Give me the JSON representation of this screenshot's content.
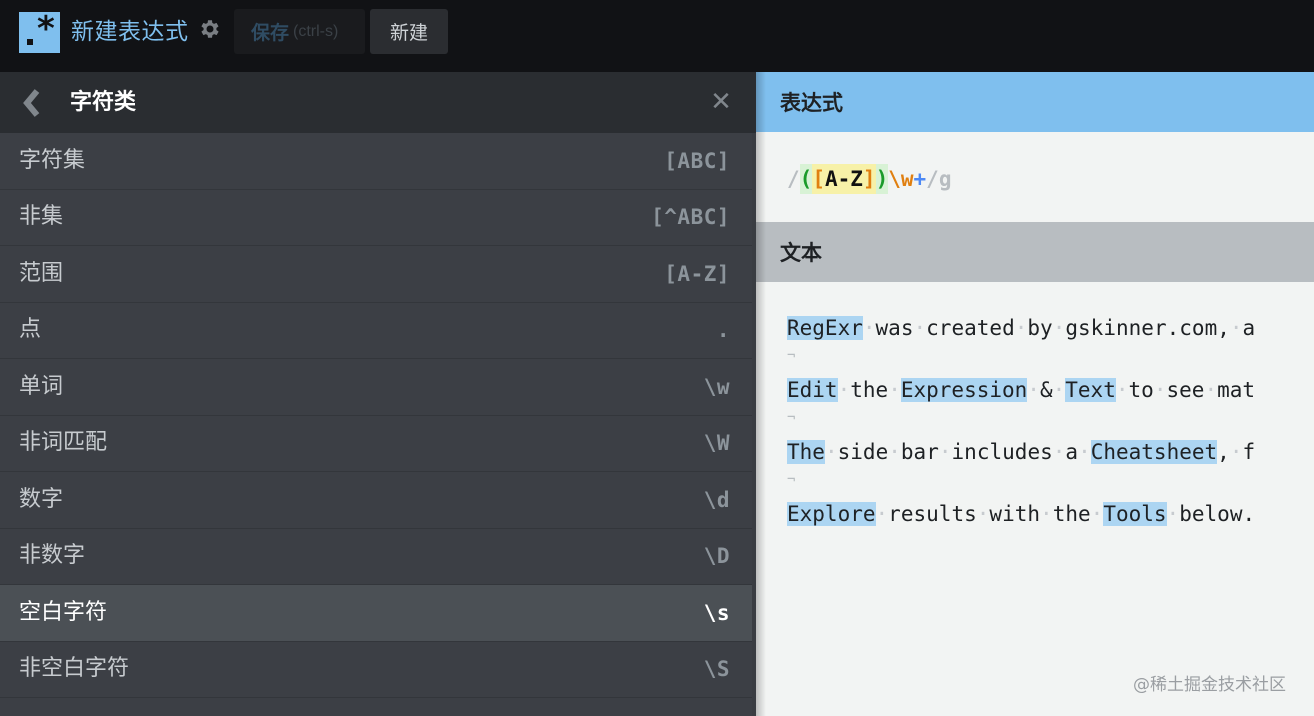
{
  "topbar": {
    "logo_icon": "regex-logo-icon",
    "title": "新建表达式",
    "settings_icon": "gear-icon",
    "save_label": "保存",
    "save_hint": "(ctrl-s)",
    "new_label": "新建"
  },
  "sidebar": {
    "back_icon": "chevron-left-icon",
    "title": "字符类",
    "close_icon": "close-icon",
    "items": [
      {
        "label": "字符集",
        "code": "[ABC]",
        "active": false
      },
      {
        "label": "非集",
        "code": "[^ABC]",
        "active": false
      },
      {
        "label": "范围",
        "code": "[A-Z]",
        "active": false
      },
      {
        "label": "点",
        "code": ".",
        "active": false
      },
      {
        "label": "单词",
        "code": "\\w",
        "active": false
      },
      {
        "label": "非词匹配",
        "code": "\\W",
        "active": false
      },
      {
        "label": "数字",
        "code": "\\d",
        "active": false
      },
      {
        "label": "非数字",
        "code": "\\D",
        "active": false
      },
      {
        "label": "空白字符",
        "code": "\\s",
        "active": true
      },
      {
        "label": "非空白字符",
        "code": "\\S",
        "active": false
      }
    ]
  },
  "expression": {
    "title": "表达式",
    "tokens": [
      {
        "text": "/",
        "kind": "slash"
      },
      {
        "text": "(",
        "kind": "paren"
      },
      {
        "text": "[",
        "kind": "brk"
      },
      {
        "text": "A-Z",
        "kind": "chr"
      },
      {
        "text": "]",
        "kind": "brk"
      },
      {
        "text": ")",
        "kind": "paren"
      },
      {
        "text": "\\w",
        "kind": "esc"
      },
      {
        "text": "+",
        "kind": "quant"
      },
      {
        "text": "/",
        "kind": "slash"
      },
      {
        "text": "g",
        "kind": "flag"
      }
    ],
    "value": "/([A-Z])\\w+/g"
  },
  "text": {
    "title": "文本",
    "newline_marker": "¬",
    "lines": [
      [
        [
          "RegExr",
          true
        ],
        [
          " was created by gskinner.com, a",
          false
        ]
      ],
      [
        [
          "Edit",
          true
        ],
        [
          " the ",
          false
        ],
        [
          "Expression",
          true
        ],
        [
          " & ",
          false
        ],
        [
          "Text",
          true
        ],
        [
          " to see mat",
          false
        ]
      ],
      [
        [
          "The",
          true
        ],
        [
          " side bar includes a ",
          false
        ],
        [
          "Cheatsheet",
          true
        ],
        [
          ", f",
          false
        ]
      ],
      [
        [
          "Explore",
          true
        ],
        [
          " results with the ",
          false
        ],
        [
          "Tools",
          true
        ],
        [
          " below.",
          false
        ]
      ]
    ]
  },
  "watermark": "@稀土掘金技术社区",
  "colors": {
    "accent": "#7fbfee",
    "match_highlight": "#acd5f2",
    "group": "#1b9b2a",
    "set": "#e07f10",
    "quantifier": "#4d89f5"
  }
}
